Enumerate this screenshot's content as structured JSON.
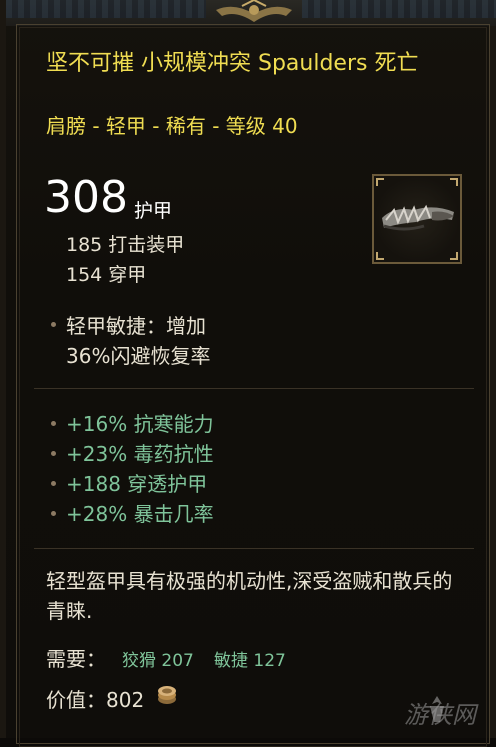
{
  "item": {
    "name": "坚不可摧 小规模冲突 Spaulders 死亡",
    "type_line": "肩膀 - 轻甲 - 稀有 - 等级 40",
    "armor": {
      "value": "308",
      "label": "护甲",
      "sub_stats": [
        "185 打击装甲",
        "154 穿甲"
      ]
    },
    "icon": "spaulders-icon",
    "implicit": {
      "line1": "轻甲敏捷：增加",
      "line2": "36%闪避恢复率"
    },
    "affixes": [
      "+16% 抗寒能力",
      "+23% 毒药抗性",
      "+188 穿透护甲",
      "+28% 暴击几率"
    ],
    "flavor": "轻型盔甲具有极强的机动性,深受盗贼和散兵的青睐.",
    "requirements": {
      "label": "需要：",
      "items": [
        "狡猾 207",
        "敏捷 127"
      ]
    },
    "value": {
      "label": "价值：802",
      "icon": "coin-icon"
    }
  },
  "watermark": "游侠网",
  "colors": {
    "title": "#f0dd52",
    "stat_white": "#e8e2d2",
    "affix_green": "#7fc49a",
    "background": "#100e0a",
    "border": "#6b5a3a"
  }
}
